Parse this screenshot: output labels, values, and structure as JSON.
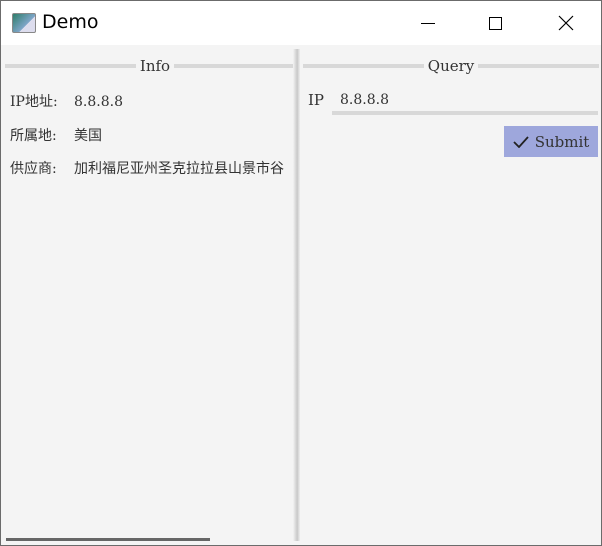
{
  "window": {
    "title": "Demo",
    "icon": "app-window-icon"
  },
  "info": {
    "legend": "Info",
    "rows": [
      {
        "label": "IP地址:",
        "value": "8.8.8.8"
      },
      {
        "label": "所属地:",
        "value": "美国"
      },
      {
        "label": "供应商:",
        "value": "加利福尼亚州圣克拉拉县山景市谷"
      }
    ]
  },
  "query": {
    "legend": "Query",
    "ip_label": "IP",
    "ip_value": "8.8.8.8",
    "submit_label": "Submit",
    "submit_icon": "check-icon",
    "accent": "#9ea7dc"
  }
}
